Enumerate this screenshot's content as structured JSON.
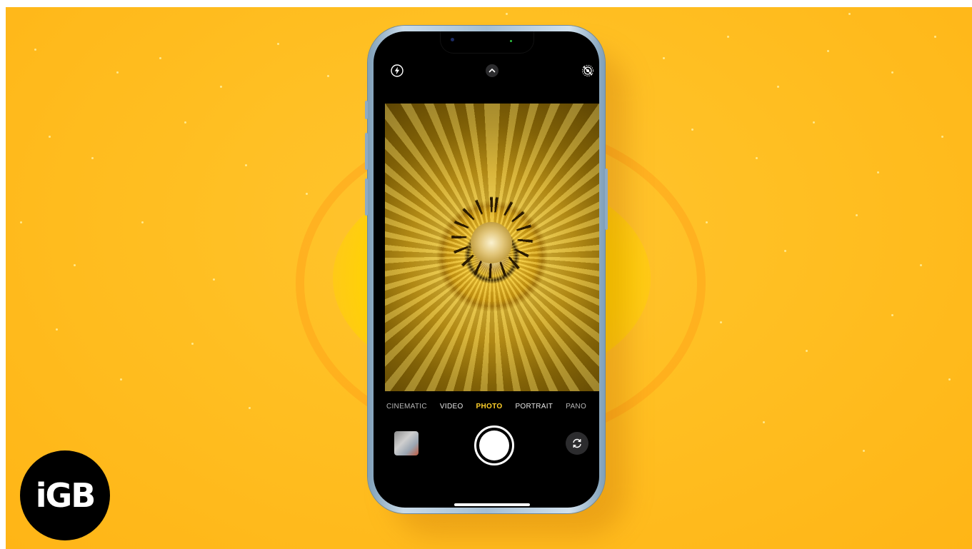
{
  "camera": {
    "modes": [
      "CINEMATIC",
      "VIDEO",
      "PHOTO",
      "PORTRAIT",
      "PANO"
    ],
    "active_mode": "PHOTO",
    "top_controls": {
      "flash_icon": "flash-icon",
      "chevron_icon": "chevron-up-icon",
      "live_photo_icon": "live-photo-off-icon"
    },
    "bottom_controls": {
      "thumbnail_icon": "photo-thumbnail",
      "shutter_icon": "shutter-button",
      "flip_icon": "flip-camera-icon"
    },
    "accent_color": "#ffd02a"
  },
  "brand": {
    "logo_text": "iGB"
  },
  "colors": {
    "background": "#ffbf22",
    "phone_frame": "#a5bfd5"
  }
}
